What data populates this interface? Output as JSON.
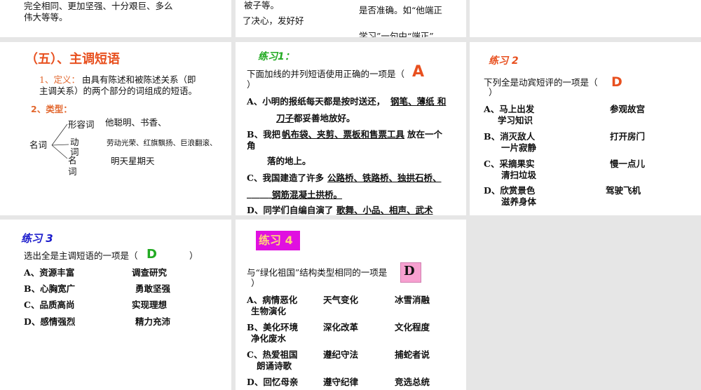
{
  "slides": {
    "top_left": {
      "lines": [
        "完全相同、更加坚强、十分艰巨、多么",
        "伟大等等。"
      ]
    },
    "top_middle": {
      "left_lines": [
        "被子等。",
        "了决心，发好好"
      ],
      "right_lines": [
        "是否准确。如“他端正",
        "学习”一句中“端正”"
      ]
    },
    "subject_predicate": {
      "title": "（五）、主调短语",
      "def_label": "1、定义：",
      "def_text_1": "由具有陈述和被陈述关系（即",
      "def_text_2": "主调关系）的两个部分的词组成的短语。",
      "type_label": "2、类型：",
      "root": "名词",
      "branches": [
        "形容词",
        "动\n词",
        "名\n词"
      ],
      "examples": [
        "他聪明、书香、",
        "劳动光荣、红旗飘扬、巨浪翻滚、",
        "明天星期天"
      ]
    },
    "exercise1": {
      "title": "练习1：",
      "question": "下面加线的并列短语使用正确的一项是（",
      "question_close": "）",
      "answer": "A",
      "a_prefix": "A、小明的报纸每天都是按时送还，",
      "a_under": "钢笔、薄纸 和",
      "a2_under": "刀子",
      "a2_rest": "都妥善地放好。",
      "b_prefix": "B、我把",
      "b_under": "帆布袋、夹剪、票板和售票工具",
      "b_rest": "放在一个",
      "b2": "角",
      "b3": "落的地上。",
      "c_prefix": "C、我国建造了许多",
      "c_under": "公路桥、铁路桥、独拱石桥、",
      "c2_blank": "______",
      "c2_under": "钢筋混凝土拱桥。",
      "d_prefix": "D、同学们自编自演了",
      "d_under": "歌舞、小品、相声、武术"
    },
    "exercise2": {
      "title": "练习 2",
      "question": "下列全是动宾短评的一项是（",
      "question_close": "）",
      "answer": "D",
      "options": [
        {
          "a": "A、马上出发",
          "b": "参观故宫",
          "c": "学习知识"
        },
        {
          "a": "B、消灭敌人",
          "b": "打开房门",
          "c": "一片寂静"
        },
        {
          "a": "C、采摘果实",
          "b": "慢一点儿",
          "c": "清扫垃圾"
        },
        {
          "a": "D、欣赏景色",
          "b": "驾驶飞机",
          "c": "滋养身体"
        }
      ]
    },
    "exercise3": {
      "title": "练习 3",
      "question": "选出全是主调短语的一项是（",
      "question_close": "）",
      "answer": "D",
      "options": [
        {
          "a": "A、资源丰富",
          "b": "调查研究"
        },
        {
          "a": "B、心胸宽广",
          "b": "勇敢坚强"
        },
        {
          "a": "C、品质高尚",
          "b": "实现理想"
        },
        {
          "a": "D、感情强烈",
          "b": "精力充沛"
        }
      ]
    },
    "exercise4": {
      "title": "练习 4",
      "question": "与“绿化祖国”结构类型相同的一项是",
      "question_close": "）",
      "answer": "D",
      "options": [
        {
          "a": "A、病情恶化",
          "b": "天气变化",
          "c": "冰雪消融",
          "d": "生物演化"
        },
        {
          "a": "B、美化环境",
          "b": "深化改革",
          "c": "文化程度",
          "d": "净化废水"
        },
        {
          "a": "C、热爱祖国",
          "b": "遵纪守法",
          "c": "捕蛇者说",
          "d": "朗诵诗歌"
        },
        {
          "a": "D、回忆母亲",
          "b": "遵守纪律",
          "c": "竞选总统",
          "d": ""
        }
      ]
    }
  },
  "colors": {
    "orange": "#e8501f",
    "green": "#22aa22",
    "blue": "#1a1acc",
    "magenta": "#e010e0",
    "pink": "#f7a0d0"
  }
}
